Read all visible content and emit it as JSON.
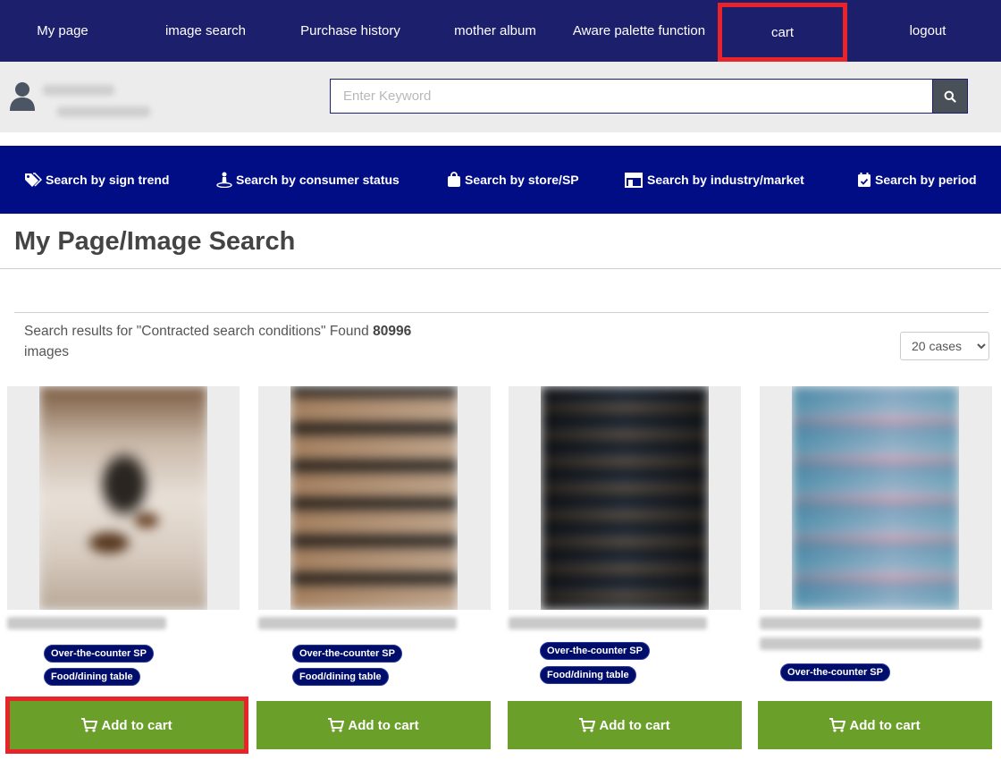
{
  "topnav": {
    "items": [
      {
        "label": "My page"
      },
      {
        "label": "image search"
      },
      {
        "label": "Purchase history"
      },
      {
        "label": "mother album"
      },
      {
        "label": "Aware palette function"
      },
      {
        "label": "cart"
      },
      {
        "label": "logout"
      }
    ]
  },
  "search": {
    "placeholder": "Enter Keyword",
    "button_icon": "search-icon"
  },
  "catnav": {
    "items": [
      {
        "label": "Search by sign trend",
        "icon": "tag-icon"
      },
      {
        "label": "Search by consumer status",
        "icon": "person-icon"
      },
      {
        "label": "Search by store/SP",
        "icon": "bag-icon"
      },
      {
        "label": "Search by industry/market",
        "icon": "store-icon"
      },
      {
        "label": "Search by period",
        "icon": "calendar-icon"
      }
    ]
  },
  "page": {
    "title": "My Page/Image Search",
    "results_prefix": "Search results for \"Contracted search conditions\" Found ",
    "results_count": "80996",
    "results_suffix": " images",
    "per_page_selected": "20 cases"
  },
  "cards": [
    {
      "tags": [
        "Over-the-counter SP",
        "Food/dining table"
      ],
      "cart_label": "Add to cart"
    },
    {
      "tags": [
        "Over-the-counter SP",
        "Food/dining table"
      ],
      "cart_label": "Add to cart"
    },
    {
      "tags": [
        "Over-the-counter SP",
        "Food/dining table"
      ],
      "cart_label": "Add to cart"
    },
    {
      "tags": [
        "Over-the-counter SP"
      ],
      "cart_label": "Add to cart"
    }
  ]
}
